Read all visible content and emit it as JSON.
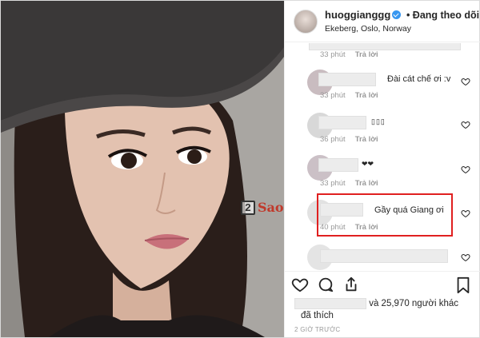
{
  "post": {
    "username": "huoggianggg",
    "follow_label": "• Đang theo dõi",
    "location": "Ekeberg, Oslo, Norway",
    "watermark_digit": "2",
    "watermark_text": "Sao"
  },
  "comments": [
    {
      "time": "33 phút",
      "reply": "Trả lời",
      "text": ""
    },
    {
      "time": "",
      "reply": "",
      "text": "Đài cát chế ơi :v"
    },
    {
      "time": "33 phút",
      "reply": "Trả lời",
      "text": "▯▯▯"
    },
    {
      "time": "36 phút",
      "reply": "Trả lời",
      "text": "❤❤"
    },
    {
      "time": "40 phút",
      "reply": "Trả lời",
      "text": "Gầy quá Giang ơi"
    }
  ],
  "likes": {
    "text": "và 25,970 người khác",
    "liked": "đã thích"
  },
  "timestamp": "2 GIỜ TRƯỚC",
  "colors": {
    "highlight": "#e02020",
    "verified": "#3897f0",
    "watermark": "#c0392b"
  }
}
